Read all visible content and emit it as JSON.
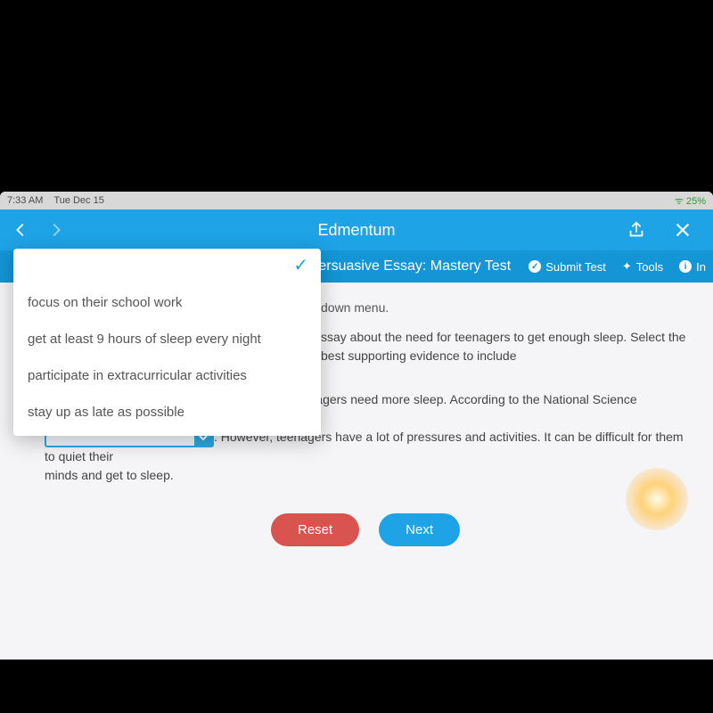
{
  "statusbar": {
    "time": "7:33 AM",
    "date": "Tue Dec 15",
    "battery": "25%"
  },
  "navbar": {
    "title": "Edmentum"
  },
  "testbar": {
    "title_fragment": "g a Persuasive Essay: Mastery Test",
    "submit": "Submit Test",
    "tools": "Tools",
    "info": "In"
  },
  "dropdown": {
    "options": [
      "focus on their school work",
      "get at least 9 hours of sleep every night",
      "participate in extracurricular activities",
      "stay up as late as possible"
    ]
  },
  "content": {
    "frag_down": "down menu.",
    "frag_essay": "ssay about the need for teenagers to get enough sleep. Select the best supporting evidence to include",
    "line1": "One reason schools should start later is that teenagers need more sleep. According to the National Science Foundation, teens should",
    "line2_after": ". However, teenagers have a lot of pressures and activities. It can be difficult for them to quiet their",
    "line3": "minds and get to sleep."
  },
  "buttons": {
    "reset": "Reset",
    "next": "Next"
  }
}
